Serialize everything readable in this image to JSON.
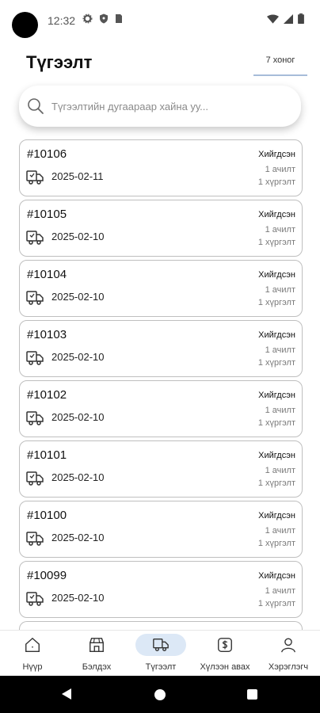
{
  "status_bar": {
    "time": "12:32",
    "icons_left": [
      "gear-icon",
      "shield-icon",
      "sim-card-icon"
    ],
    "icons_right": [
      "wifi-icon",
      "signal-icon",
      "battery-icon"
    ]
  },
  "header": {
    "title": "Түгээлт",
    "range_filter": "7 хоног"
  },
  "search": {
    "placeholder": "Түгээлтийн дугаараар хайна уу..."
  },
  "deliveries": [
    {
      "id": "#10106",
      "date": "2025-02-11",
      "status": "Хийгдсэн",
      "tasks": "1 ачилт",
      "deliveries": "1 хүргэлт"
    },
    {
      "id": "#10105",
      "date": "2025-02-10",
      "status": "Хийгдсэн",
      "tasks": "1 ачилт",
      "deliveries": "1 хүргэлт"
    },
    {
      "id": "#10104",
      "date": "2025-02-10",
      "status": "Хийгдсэн",
      "tasks": "1 ачилт",
      "deliveries": "1 хүргэлт"
    },
    {
      "id": "#10103",
      "date": "2025-02-10",
      "status": "Хийгдсэн",
      "tasks": "1 ачилт",
      "deliveries": "1 хүргэлт"
    },
    {
      "id": "#10102",
      "date": "2025-02-10",
      "status": "Хийгдсэн",
      "tasks": "1 ачилт",
      "deliveries": "1 хүргэлт"
    },
    {
      "id": "#10101",
      "date": "2025-02-10",
      "status": "Хийгдсэн",
      "tasks": "1 ачилт",
      "deliveries": "1 хүргэлт"
    },
    {
      "id": "#10100",
      "date": "2025-02-10",
      "status": "Хийгдсэн",
      "tasks": "1 ачилт",
      "deliveries": "1 хүргэлт"
    },
    {
      "id": "#10099",
      "date": "2025-02-10",
      "status": "Хийгдсэн",
      "tasks": "1 ачилт",
      "deliveries": "1 хүргэлт"
    }
  ],
  "bottom_nav": [
    {
      "label": "Нүүр",
      "icon": "home-icon",
      "active": false
    },
    {
      "label": "Бэлдэх",
      "icon": "store-icon",
      "active": false
    },
    {
      "label": "Түгээлт",
      "icon": "delivery-truck-icon",
      "active": true
    },
    {
      "label": "Хүлээн авах",
      "icon": "dollar-box-icon",
      "active": false
    },
    {
      "label": "Хэрэглэгч",
      "icon": "user-icon",
      "active": false
    }
  ],
  "colors": {
    "accent": "#a7bcd9",
    "active_nav_bg": "#dce8f6",
    "card_border": "#bfbfbf"
  }
}
